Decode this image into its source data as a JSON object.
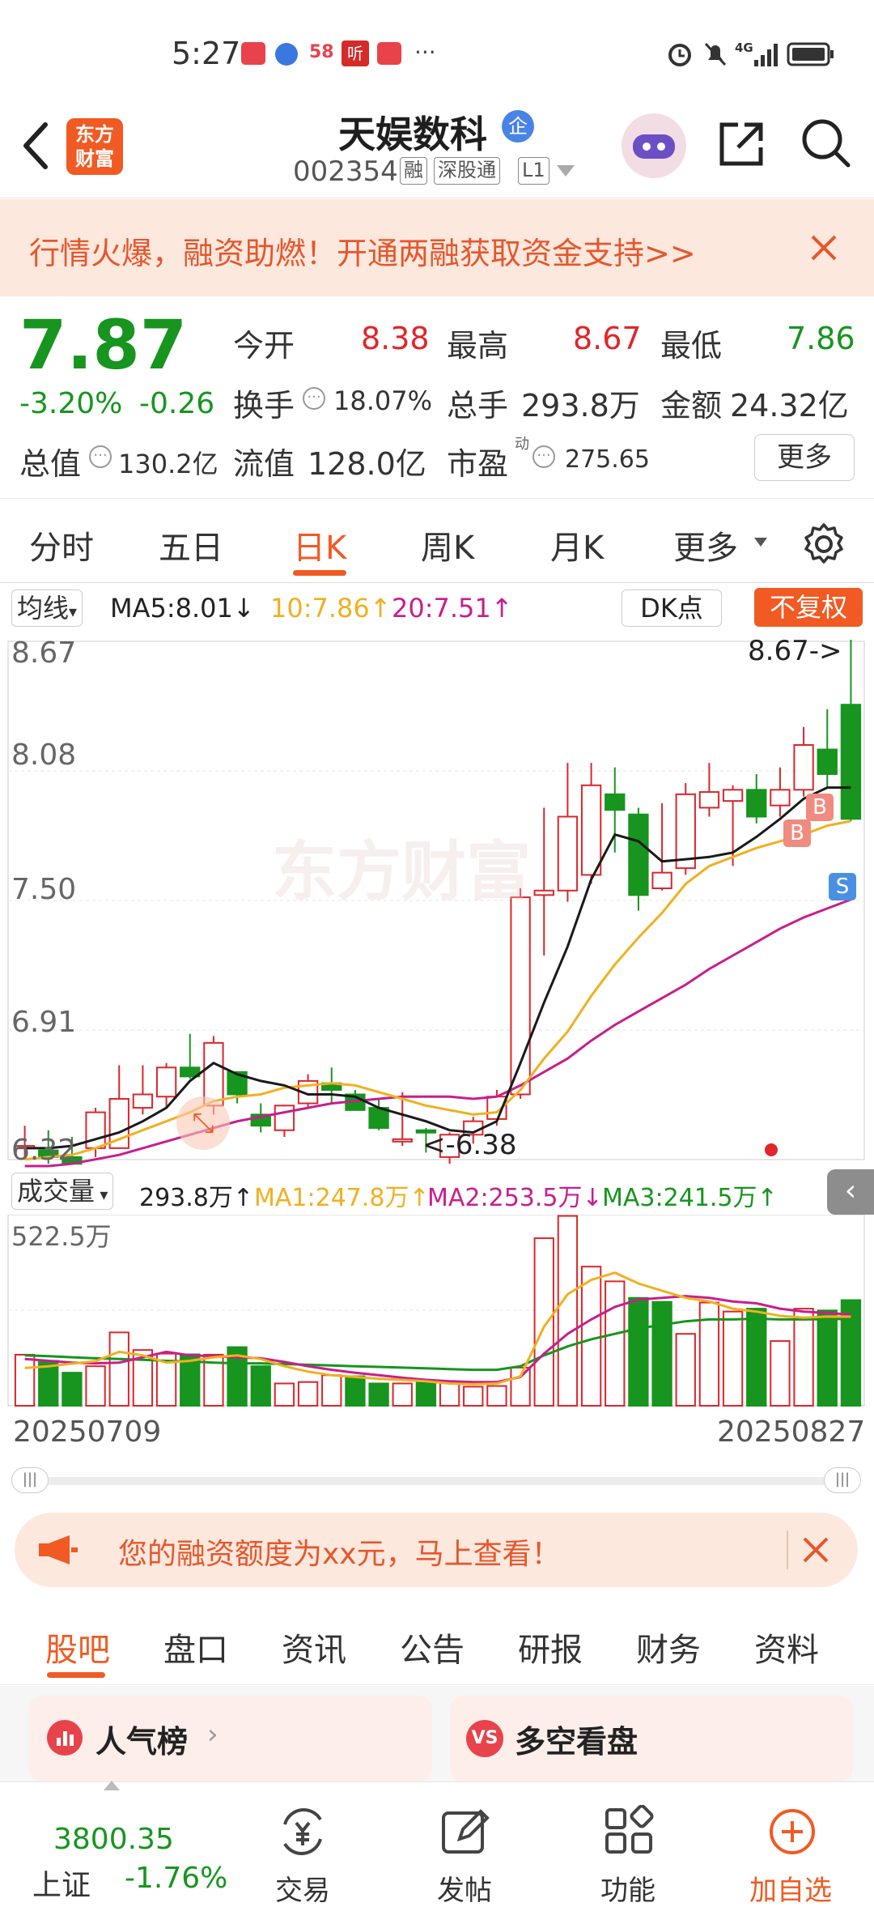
{
  "status_bar": {
    "time": "5:27",
    "notif_icons": [
      "58",
      "听"
    ],
    "more": "···",
    "network": "4G"
  },
  "header": {
    "logo_line1": "东方",
    "logo_line2": "财富",
    "stock_name": "天娱数科",
    "badge": "企",
    "stock_code": "002354",
    "tag_margin": "融",
    "tag_connect": "深股通",
    "tag_level": "L1"
  },
  "banner": {
    "text": "行情火爆，融资助燃！开通两融获取资金支持>>"
  },
  "quote": {
    "price": "7.87",
    "change_pct": "-3.20%",
    "change_amt": "-0.26",
    "open_label": "今开",
    "open_value": "8.38",
    "high_label": "最高",
    "high_value": "8.67",
    "low_label": "最低",
    "low_value": "7.86",
    "turnover_label": "换手",
    "turnover_value": "18.07%",
    "volume_label": "总手",
    "volume_value": "293.8万",
    "amount_label": "金额",
    "amount_value": "24.32亿",
    "mktcap_label": "总值",
    "mktcap_value": "130.2亿",
    "float_label": "流值",
    "float_value": "128.0亿",
    "pe_label": "市盈",
    "pe_sup": "动",
    "pe_value": "275.65",
    "more_button": "更多"
  },
  "period_tabs": [
    {
      "label": "分时",
      "active": false
    },
    {
      "label": "五日",
      "active": false
    },
    {
      "label": "日K",
      "active": true
    },
    {
      "label": "周K",
      "active": false
    },
    {
      "label": "月K",
      "active": false
    },
    {
      "label": "更多",
      "active": false
    }
  ],
  "kline_legend": {
    "selector": "均线",
    "ma5": "MA5:8.01↓",
    "ma10": "10:7.86↑",
    "ma20": "20:7.51↑",
    "dk_button": "DK点",
    "adjust_button": "不复权"
  },
  "volume_legend": {
    "selector": "成交量",
    "vol": "293.8万↑",
    "ma1": "MA1:247.8万↑",
    "ma2": "MA2:253.5万↓",
    "ma3": "MA3:241.5万↑"
  },
  "colors": {
    "up": "#d9262c",
    "down": "#17951f",
    "ma5": "#1a1a1a",
    "ma10": "#f0b020",
    "ma20": "#c81e8c",
    "accent": "#f15a22"
  },
  "chart_data": [
    {
      "type": "candlestick",
      "title": "",
      "y_ticks": [
        "8.67",
        "8.08",
        "7.50",
        "6.91",
        "6.32"
      ],
      "ylim": [
        6.32,
        8.67
      ],
      "max_annotation": "8.67->",
      "min_annotation": "<-6.38",
      "watermark": "东方财富",
      "signals": [
        "B",
        "B",
        "S"
      ],
      "candles": [
        {
          "o": 6.41,
          "h": 6.5,
          "l": 6.35,
          "c": 6.41
        },
        {
          "o": 6.39,
          "h": 6.48,
          "l": 6.33,
          "c": 6.36
        },
        {
          "o": 6.36,
          "h": 6.45,
          "l": 6.33,
          "c": 6.33
        },
        {
          "o": 6.4,
          "h": 6.58,
          "l": 6.36,
          "c": 6.56
        },
        {
          "o": 6.4,
          "h": 6.77,
          "l": 6.4,
          "c": 6.62
        },
        {
          "o": 6.58,
          "h": 6.77,
          "l": 6.55,
          "c": 6.64
        },
        {
          "o": 6.63,
          "h": 6.78,
          "l": 6.58,
          "c": 6.76
        },
        {
          "o": 6.76,
          "h": 6.91,
          "l": 6.71,
          "c": 6.72
        },
        {
          "o": 6.59,
          "h": 6.9,
          "l": 6.55,
          "c": 6.87
        },
        {
          "o": 6.74,
          "h": 6.74,
          "l": 6.6,
          "c": 6.64
        },
        {
          "o": 6.55,
          "h": 6.6,
          "l": 6.47,
          "c": 6.5
        },
        {
          "o": 6.48,
          "h": 6.59,
          "l": 6.45,
          "c": 6.59
        },
        {
          "o": 6.6,
          "h": 6.73,
          "l": 6.58,
          "c": 6.7
        },
        {
          "o": 6.69,
          "h": 6.76,
          "l": 6.6,
          "c": 6.66
        },
        {
          "o": 6.64,
          "h": 6.66,
          "l": 6.57,
          "c": 6.57
        },
        {
          "o": 6.58,
          "h": 6.62,
          "l": 6.48,
          "c": 6.49
        },
        {
          "o": 6.43,
          "h": 6.65,
          "l": 6.41,
          "c": 6.44
        },
        {
          "o": 6.48,
          "h": 6.49,
          "l": 6.38,
          "c": 6.47
        },
        {
          "o": 6.36,
          "h": 6.47,
          "l": 6.33,
          "c": 6.46
        },
        {
          "o": 6.46,
          "h": 6.54,
          "l": 6.42,
          "c": 6.52
        },
        {
          "o": 6.53,
          "h": 6.66,
          "l": 6.5,
          "c": 6.63
        },
        {
          "o": 6.64,
          "h": 7.56,
          "l": 6.62,
          "c": 7.52
        },
        {
          "o": 7.53,
          "h": 7.92,
          "l": 7.26,
          "c": 7.55
        },
        {
          "o": 7.55,
          "h": 8.12,
          "l": 7.5,
          "c": 7.88
        },
        {
          "o": 7.62,
          "h": 8.12,
          "l": 7.58,
          "c": 8.02
        },
        {
          "o": 7.98,
          "h": 8.1,
          "l": 7.72,
          "c": 7.91
        },
        {
          "o": 7.89,
          "h": 7.92,
          "l": 7.46,
          "c": 7.53
        },
        {
          "o": 7.56,
          "h": 7.94,
          "l": 7.55,
          "c": 7.63
        },
        {
          "o": 7.65,
          "h": 8.03,
          "l": 7.62,
          "c": 7.98
        },
        {
          "o": 7.92,
          "h": 8.12,
          "l": 7.88,
          "c": 7.99
        },
        {
          "o": 7.95,
          "h": 8.02,
          "l": 7.66,
          "c": 8.0
        },
        {
          "o": 8.0,
          "h": 8.07,
          "l": 7.85,
          "c": 7.88
        },
        {
          "o": 7.93,
          "h": 8.1,
          "l": 7.88,
          "c": 8.0
        },
        {
          "o": 8.0,
          "h": 8.28,
          "l": 7.97,
          "c": 8.2
        },
        {
          "o": 8.18,
          "h": 8.36,
          "l": 8.01,
          "c": 8.07
        },
        {
          "o": 8.38,
          "h": 8.67,
          "l": 7.86,
          "c": 7.87
        }
      ],
      "ma5": [
        6.4,
        6.4,
        6.41,
        6.44,
        6.47,
        6.52,
        6.58,
        6.7,
        6.78,
        6.73,
        6.7,
        6.68,
        6.64,
        6.64,
        6.63,
        6.58,
        6.55,
        6.52,
        6.48,
        6.47,
        6.52,
        6.78,
        7.05,
        7.3,
        7.6,
        7.8,
        7.77,
        7.68,
        7.69,
        7.7,
        7.72,
        7.79,
        7.87,
        7.96,
        8.01,
        8.01
      ],
      "ma10": [
        6.35,
        6.36,
        6.37,
        6.4,
        6.44,
        6.48,
        6.52,
        6.56,
        6.61,
        6.63,
        6.64,
        6.67,
        6.68,
        6.69,
        6.68,
        6.65,
        6.62,
        6.59,
        6.57,
        6.55,
        6.56,
        6.66,
        6.8,
        6.92,
        7.08,
        7.22,
        7.34,
        7.45,
        7.58,
        7.66,
        7.7,
        7.74,
        7.77,
        7.8,
        7.84,
        7.86
      ],
      "ma20": [
        6.32,
        6.32,
        6.33,
        6.35,
        6.37,
        6.4,
        6.43,
        6.46,
        6.49,
        6.52,
        6.54,
        6.56,
        6.58,
        6.6,
        6.61,
        6.62,
        6.63,
        6.63,
        6.63,
        6.62,
        6.63,
        6.68,
        6.74,
        6.8,
        6.88,
        6.95,
        7.01,
        7.07,
        7.13,
        7.2,
        7.26,
        7.32,
        7.38,
        7.43,
        7.47,
        7.51
      ]
    },
    {
      "type": "bar",
      "title": "",
      "y_tick": "522.5万",
      "ylim": [
        0,
        522.5
      ],
      "x_start": "20250709",
      "x_end": "20250827",
      "volumes": [
        142,
        125,
        92,
        110,
        204,
        155,
        145,
        143,
        142,
        163,
        110,
        62,
        66,
        85,
        82,
        62,
        62,
        64,
        66,
        53,
        55,
        106,
        466,
        528,
        387,
        346,
        300,
        289,
        200,
        287,
        262,
        270,
        180,
        270,
        265,
        293.8
      ],
      "up": [
        true,
        false,
        false,
        true,
        true,
        true,
        true,
        false,
        true,
        false,
        false,
        true,
        true,
        true,
        false,
        false,
        true,
        false,
        true,
        true,
        true,
        true,
        true,
        true,
        true,
        true,
        false,
        false,
        true,
        true,
        true,
        false,
        true,
        true,
        false,
        false
      ],
      "ma1": [
        105,
        110,
        117,
        124,
        150,
        140,
        120,
        125,
        135,
        140,
        130,
        110,
        95,
        85,
        80,
        75,
        72,
        68,
        62,
        60,
        62,
        82,
        220,
        310,
        350,
        370,
        340,
        320,
        300,
        290,
        270,
        262,
        250,
        245,
        248,
        247.8
      ],
      "ma2": [
        130,
        125,
        120,
        118,
        120,
        135,
        150,
        140,
        138,
        135,
        132,
        122,
        110,
        100,
        92,
        85,
        78,
        72,
        68,
        66,
        66,
        80,
        145,
        200,
        240,
        275,
        295,
        300,
        305,
        300,
        290,
        285,
        270,
        262,
        258,
        253.5
      ],
      "ma3": [
        140,
        138,
        135,
        132,
        130,
        128,
        125,
        123,
        120,
        118,
        118,
        116,
        114,
        112,
        110,
        108,
        106,
        104,
        102,
        100,
        100,
        110,
        140,
        165,
        185,
        200,
        215,
        225,
        235,
        240,
        240,
        242,
        240,
        240,
        241,
        241.5
      ]
    }
  ],
  "notice": {
    "text": "您的融资额度为xx元，马上查看！"
  },
  "bottom_tabs": [
    {
      "label": "股吧",
      "active": true
    },
    {
      "label": "盘口",
      "active": false
    },
    {
      "label": "资讯",
      "active": false
    },
    {
      "label": "公告",
      "active": false
    },
    {
      "label": "研报",
      "active": false
    },
    {
      "label": "财务",
      "active": false
    },
    {
      "label": "资料",
      "active": false
    }
  ],
  "cards": {
    "popular": "人气榜",
    "bull_bear": "多空看盘"
  },
  "bottom_nav": {
    "index_value": "3800.35",
    "index_name": "上证",
    "index_change": "-1.76%",
    "trade": "交易",
    "post": "发帖",
    "functions": "功能",
    "add_watch": "加自选"
  }
}
